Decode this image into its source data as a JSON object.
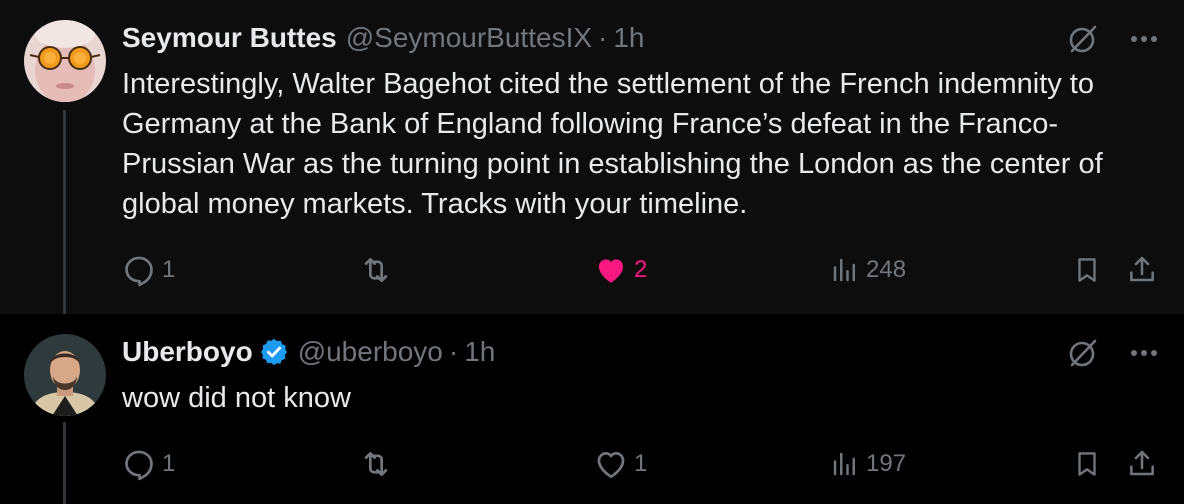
{
  "tweets": [
    {
      "display_name": "Seymour Buttes",
      "handle": "@SeymourButtesIX",
      "separator": "·",
      "time": "1h",
      "verified": false,
      "text": "Interestingly, Walter Bagehot cited the settlement of the French indemnity to Germany at the Bank of England following France’s defeat in the Franco-Prussian War as the turning point in establishing the London as the center of global money markets. Tracks with your timeline.",
      "replies": "1",
      "reposts": "",
      "likes": "2",
      "liked": true,
      "views": "248"
    },
    {
      "display_name": "Uberboyo",
      "handle": "@uberboyo",
      "separator": "·",
      "time": "1h",
      "verified": true,
      "text": "wow did not know",
      "replies": "1",
      "reposts": "",
      "likes": "1",
      "liked": false,
      "views": "197"
    }
  ],
  "colors": {
    "background_1": "#0d0d0d",
    "background_2": "#000000",
    "text_primary": "#e7e9ea",
    "text_secondary": "#71767b",
    "like_active": "#f91880",
    "verified_badge": "#1d9bf0"
  },
  "icons": {
    "reply": "reply-icon",
    "repost": "repost-icon",
    "like": "heart-icon",
    "views": "views-icon",
    "bookmark": "bookmark-icon",
    "share": "share-icon",
    "grok": "grok-icon",
    "more": "more-icon"
  }
}
